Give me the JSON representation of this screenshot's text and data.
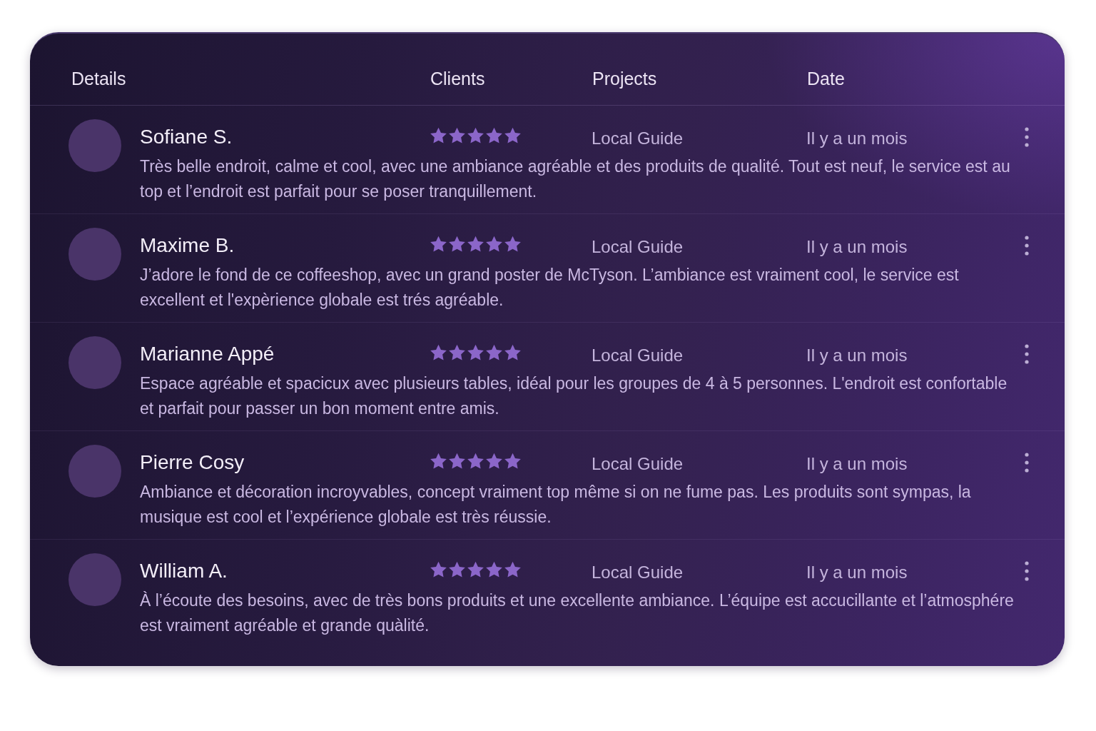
{
  "table": {
    "columns": [
      "Details",
      "Clients",
      "Projects",
      "Date"
    ],
    "rows": [
      {
        "name": "Sofiane S.",
        "stars": 5,
        "status": "Local Guide",
        "date": "Il y a un mois",
        "review": "Très belle endroit, calme et cool, avec une ambiance agréable et des produits de qualité. Tout est neuf, le service est au top et l’endroit est parfait pour se poser tranquillement."
      },
      {
        "name": "Maxime B.",
        "stars": 5,
        "status": "Local Guide",
        "date": "Il y a un mois",
        "review": "J’adore le fond de ce coffeeshop, avec un grand poster de McTyson. L’ambiance est vraiment cool, le service est excellent et l'expèrience globale est trés agréable."
      },
      {
        "name": "Marianne Appé",
        "stars": 5,
        "status": "Local Guide",
        "date": "Il y a un mois",
        "review": "Espace agréable et spacicux avec plusieurs tables, idéal pour les groupes de 4 à 5 personnes. L'endroit est confortable et parfait pour passer un bon moment entre amis."
      },
      {
        "name": "Pierre Cosy",
        "stars": 5,
        "status": "Local Guide",
        "date": "Il y a un mois",
        "review": "Ambiance et décoration incroyvables, concept vraiment top même si on ne fume pas. Les produits sont sympas, la musique est cool et l’expérience globale est très réussie."
      },
      {
        "name": "William A.",
        "stars": 5,
        "status": "Local Guide",
        "date": "Il y a un mois",
        "review": "À l’écoute des besoins, avec de très bons produits et une excellente ambiance. L’équipe est accucillante et l’atmosphére est vraiment agréable et grande quàlité."
      }
    ]
  }
}
